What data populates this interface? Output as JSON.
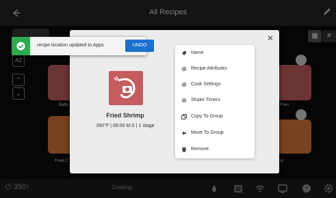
{
  "header": {
    "title": "All Recipes"
  },
  "grid": {
    "az_label": "AZ",
    "tiles": [
      {
        "label": "Batte",
        "color": "#c35d60"
      },
      {
        "label": "Fries",
        "color": "#c35d60"
      },
      {
        "label": "Fried C",
        "color": "#d9783a"
      },
      {
        "label": "ut",
        "color": "#d9783a"
      }
    ]
  },
  "modal": {
    "recipe": {
      "name": "Fried Shrimp",
      "meta": "350°F | 06:00 M:S | 1 stage",
      "icon": "shrimp-icon"
    },
    "menu": [
      {
        "label": "Name",
        "icon": "tag-icon"
      },
      {
        "label": "Recipe Attributes",
        "icon": "gear-icon"
      },
      {
        "label": "Cook Settings",
        "icon": "gear-icon"
      },
      {
        "label": "Shake Timers",
        "icon": "gear-icon"
      },
      {
        "label": "Copy To Group",
        "icon": "copy-icon"
      },
      {
        "label": "Move To Group",
        "icon": "move-icon"
      },
      {
        "label": "Remove",
        "icon": "trash-icon"
      }
    ]
  },
  "toast": {
    "message": "recipe location updated to Apps",
    "action": "UNDO"
  },
  "bottombar": {
    "temperature": "350↑",
    "status": "Cooking"
  },
  "colors": {
    "accent": "#1a6fcf",
    "success": "#2faa4f",
    "tile_red": "#c35d60",
    "tile_orange": "#d9783a"
  }
}
